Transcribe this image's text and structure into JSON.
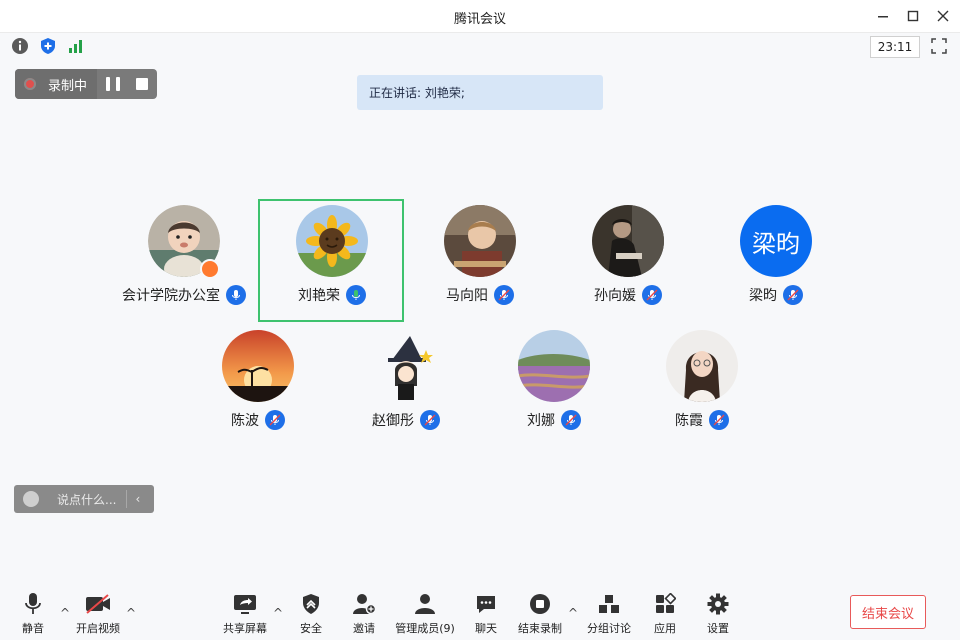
{
  "window": {
    "title": "腾讯会议"
  },
  "infobar": {
    "clock": "23:11"
  },
  "recording": {
    "label": "录制中"
  },
  "speaking": {
    "text": "正在讲话: 刘艳荣;"
  },
  "participants": [
    {
      "name": "会计学院办公室",
      "mic": "on",
      "host": true
    },
    {
      "name": "刘艳荣",
      "mic": "speaking",
      "active": true
    },
    {
      "name": "马向阳",
      "mic": "muted"
    },
    {
      "name": "孙向媛",
      "mic": "muted"
    },
    {
      "name": "梁昀",
      "mic": "muted",
      "initials": "梁昀"
    },
    {
      "name": "陈波",
      "mic": "muted"
    },
    {
      "name": "赵御彤",
      "mic": "muted"
    },
    {
      "name": "刘娜",
      "mic": "muted"
    },
    {
      "name": "陈霞",
      "mic": "muted"
    }
  ],
  "chat": {
    "placeholder": "说点什么..."
  },
  "toolbar": {
    "mute": "静音",
    "video": "开启视频",
    "share": "共享屏幕",
    "security": "安全",
    "invite": "邀请",
    "members": "管理成员(9)",
    "chat": "聊天",
    "end_recording": "结束录制",
    "breakout": "分组讨论",
    "apps": "应用",
    "settings": "设置",
    "end_meeting": "结束会议"
  },
  "colors": {
    "accent": "#1e6fe8",
    "speaking": "#3ec26e",
    "danger": "#e84848"
  }
}
